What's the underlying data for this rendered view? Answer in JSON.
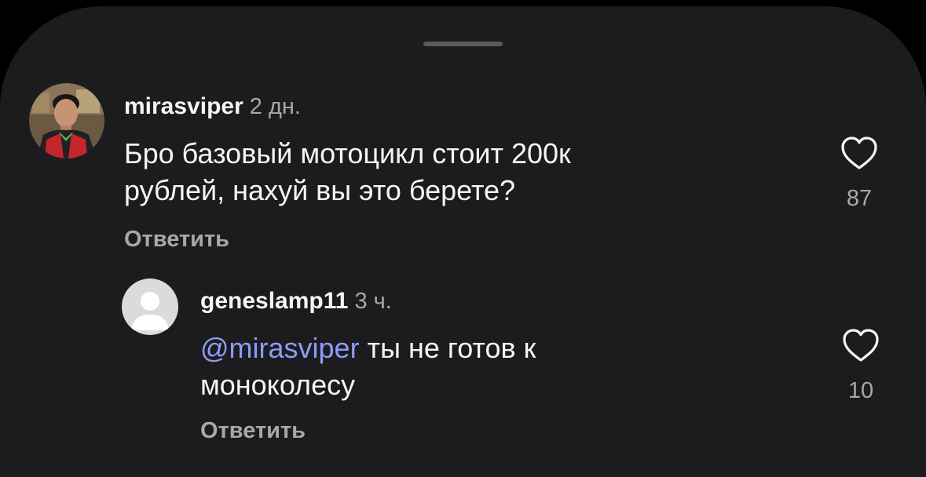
{
  "comments": [
    {
      "username": "mirasviper",
      "time": "2 дн.",
      "line1": "Бро базовый мотоцикл стоит 200к",
      "line2": "рублей, нахуй вы это берете?",
      "reply_label": "Ответить",
      "likes": "87",
      "avatar": "user-photo"
    },
    {
      "username": "geneslamp11",
      "time": "3 ч.",
      "mention": "@mirasviper",
      "line1_rest": " ты не готов к",
      "line2": "моноколесу",
      "reply_label": "Ответить",
      "likes": "10",
      "avatar": "default-avatar"
    }
  ],
  "colors": {
    "background": "#1c1c1e",
    "text": "#f5f5f5",
    "secondary": "#a8a8a8",
    "mention": "#8c9cf5"
  },
  "icons": {
    "like": "heart-outline-icon",
    "avatar_placeholder": "person-silhouette-icon"
  }
}
